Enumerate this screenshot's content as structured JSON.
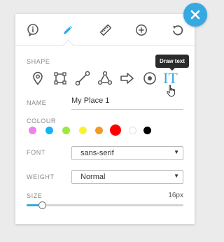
{
  "toolbar": {
    "icons": [
      "info-icon",
      "pencil-icon",
      "ruler-icon",
      "plus-circle-icon",
      "undo-icon"
    ],
    "active": "pencil-icon"
  },
  "close_icon": "close-icon",
  "shape": {
    "label": "SHAPE",
    "tools": [
      "map-pin-icon",
      "rectangle-icon",
      "line-icon",
      "polygon-icon",
      "arrow-icon",
      "circle-icon",
      "text-icon"
    ],
    "text_tool_glyph": "IT",
    "tooltip": "Draw text"
  },
  "name": {
    "label": "NAME",
    "value": "My Place 1"
  },
  "colour": {
    "label": "COLOUR",
    "swatches": [
      "#ee82ee",
      "#1ab2ee",
      "#9be93f",
      "#f9f234",
      "#f09a27",
      "#ff0000",
      "#ffffff",
      "#000000"
    ],
    "selected": "#ff0000"
  },
  "font": {
    "label": "FONT",
    "value": "sans-serif"
  },
  "weight": {
    "label": "WEIGHT",
    "value": "Normal"
  },
  "size": {
    "label": "SIZE",
    "value_text": "16px",
    "level": 0.1
  },
  "colors": {
    "accent": "#35a9e1",
    "icon": "#555555"
  }
}
